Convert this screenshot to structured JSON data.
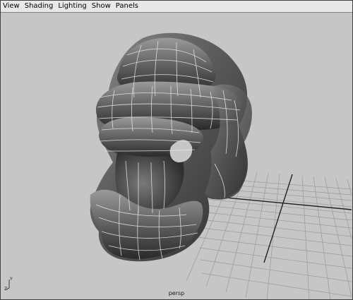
{
  "menubar": {
    "items": [
      "View",
      "Shading",
      "Lighting",
      "Show",
      "Panels"
    ]
  },
  "viewport": {
    "camera_label": "persp",
    "axis_labels": {
      "z": "Z",
      "y": "Y"
    }
  },
  "colors": {
    "viewport_bg": "#c6c6c6",
    "grid_line": "#9a9a9a",
    "grid_axis": "#202020",
    "mesh_fill": "#5e5e5e",
    "mesh_wire": "#e8e8e8"
  }
}
